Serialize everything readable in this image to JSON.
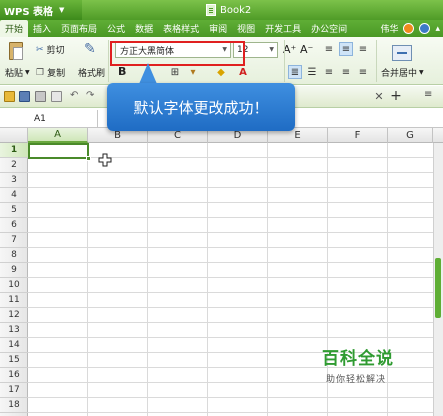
{
  "app": {
    "name": "WPS 表格",
    "document_title": "Book2"
  },
  "menu": {
    "items": [
      "开始",
      "插入",
      "页面布局",
      "公式",
      "数据",
      "表格样式",
      "审阅",
      "视图",
      "开发工具",
      "办公空间"
    ],
    "right_label": "伟华"
  },
  "ribbon": {
    "paste": "粘贴",
    "cut": "剪切",
    "copy": "复制",
    "format_painter": "格式刷",
    "font_name": "方正大黑简体",
    "font_size": "12",
    "grow_font": "A⁺",
    "shrink_font": "A⁻",
    "bold": "B",
    "merge_center": "合并居中"
  },
  "quickbar": {
    "undo": "↶",
    "redo": "↷",
    "close": "✕",
    "add": "+",
    "menu": "≡"
  },
  "formula_bar": {
    "cell_ref": "A1"
  },
  "grid": {
    "columns": [
      "A",
      "B",
      "C",
      "D",
      "E",
      "F",
      "G"
    ],
    "rows": [
      "1",
      "2",
      "3",
      "4",
      "5",
      "6",
      "7",
      "8",
      "9",
      "10",
      "11",
      "12",
      "13",
      "14",
      "15",
      "16",
      "17",
      "18"
    ],
    "selected_cell": "A1"
  },
  "callout": {
    "text": "默认字体更改成功！"
  },
  "watermark": {
    "title": "百科全说",
    "subtitle": "助你轻松解决"
  },
  "colors": {
    "title_green": "#4f9b27",
    "callout_blue": "#2e7fd6",
    "highlight_red": "#e02020",
    "watermark_green": "#2f9b31"
  }
}
